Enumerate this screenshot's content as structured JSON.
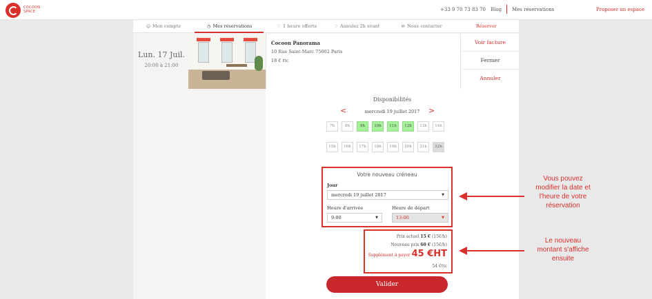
{
  "topbar": {
    "logo_line1": "COCOON",
    "logo_line2": "SPACE",
    "phone": "+33 9 70 73 83 70",
    "blog": "Blog",
    "reservations": "Mes réservations",
    "propose": "Proposer un espace"
  },
  "nav": {
    "account": "Mon compte",
    "reservations": "Mes réservations",
    "free_hour": "1 heure offerte",
    "cancel": "Annulez 2h avant",
    "contact": "Nous contacter",
    "reserve": "Réserver"
  },
  "booking": {
    "date": "Lun. 17 Juil.",
    "time": "20:00 à 21:00",
    "name": "Cocoon Panorama",
    "address": "10 Rue Saint-Marc 75002 Paris",
    "price": "18 € ttc",
    "invoice": "Voir facture",
    "close": "Fermer",
    "cancel": "Annuler"
  },
  "availability": {
    "title": "Disponibilités",
    "date": "mercredi 19 juillet 2017",
    "prev": "<",
    "next": ">",
    "row1": [
      {
        "label": "7h",
        "state": "free"
      },
      {
        "label": "8h",
        "state": "free"
      },
      {
        "label": "9h",
        "state": "selected"
      },
      {
        "label": "10h",
        "state": "selected"
      },
      {
        "label": "11h",
        "state": "selected"
      },
      {
        "label": "12h",
        "state": "selected"
      },
      {
        "label": "13h",
        "state": "free"
      },
      {
        "label": "14h",
        "state": "free"
      }
    ],
    "row2": [
      {
        "label": "15h",
        "state": "free"
      },
      {
        "label": "16h",
        "state": "free"
      },
      {
        "label": "17h",
        "state": "free"
      },
      {
        "label": "18h",
        "state": "free"
      },
      {
        "label": "19h",
        "state": "free"
      },
      {
        "label": "20h",
        "state": "free"
      },
      {
        "label": "21h",
        "state": "free"
      },
      {
        "label": "22h",
        "state": "unavailable"
      }
    ]
  },
  "new_slot": {
    "title": "Votre nouveau créneau",
    "day_label": "Jour",
    "day_value": "mercredi 19 juillet 2017",
    "arrival_label": "Heure d'arrivée",
    "arrival_value": "9:00",
    "departure_label": "Heure de départ",
    "departure_value": "13:00"
  },
  "pricing": {
    "current_label": "Prix actuel",
    "current_value": "15 €",
    "current_rate": "(15€/h)",
    "new_label": "Nouveau prix",
    "new_value": "60 €",
    "new_rate": "(15€/h)",
    "supplement_label": "Supplément à payer",
    "supplement_value": "45 €HT",
    "ttc": "54 €ttc"
  },
  "validate_label": "Valider",
  "annotations": {
    "modify": [
      "Vous pouvez",
      "modifier la date et",
      "l'heure de votre",
      "réservation"
    ],
    "amount": [
      "Le nouveau",
      "montant s'affiche",
      "ensuite"
    ]
  },
  "colors": {
    "accent": "#d9302b",
    "slot_selected": "#a6f29a",
    "button": "#c8282d"
  }
}
